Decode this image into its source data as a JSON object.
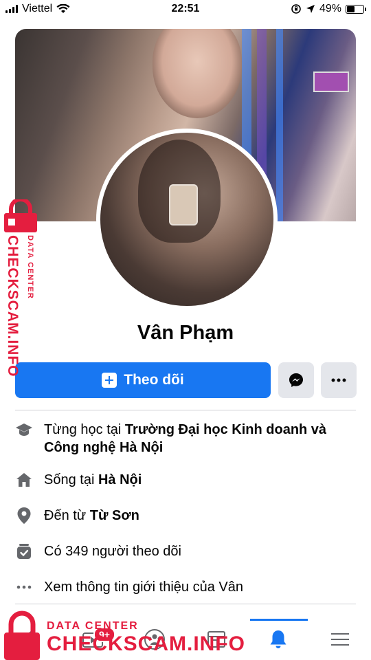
{
  "status_bar": {
    "carrier": "Viettel",
    "time": "22:51",
    "battery_percent": "49%",
    "battery_level": 0.49
  },
  "profile": {
    "name": "Vân Phạm"
  },
  "actions": {
    "follow_label": "Theo dõi"
  },
  "info": {
    "education": {
      "prefix": "Từng học tại ",
      "place": "Trường Đại học Kinh doanh và Công nghệ Hà Nội"
    },
    "lives": {
      "prefix": "Sống tại ",
      "place": "Hà Nội"
    },
    "from": {
      "prefix": "Đến từ ",
      "place": "Từ Sơn"
    },
    "followers": {
      "text": "Có 349 người theo dõi"
    },
    "about": {
      "text": "Xem thông tin giới thiệu của Vân"
    }
  },
  "tabbar": {
    "video_badge": "9+",
    "active_tab": "notifications"
  },
  "watermark": {
    "brand": "CHECKSCAM.INFO",
    "subtitle": "DATA CENTER"
  },
  "colors": {
    "accent": "#1877f2",
    "watermark": "#e41e3f",
    "secondary_button": "#e4e6eb"
  }
}
